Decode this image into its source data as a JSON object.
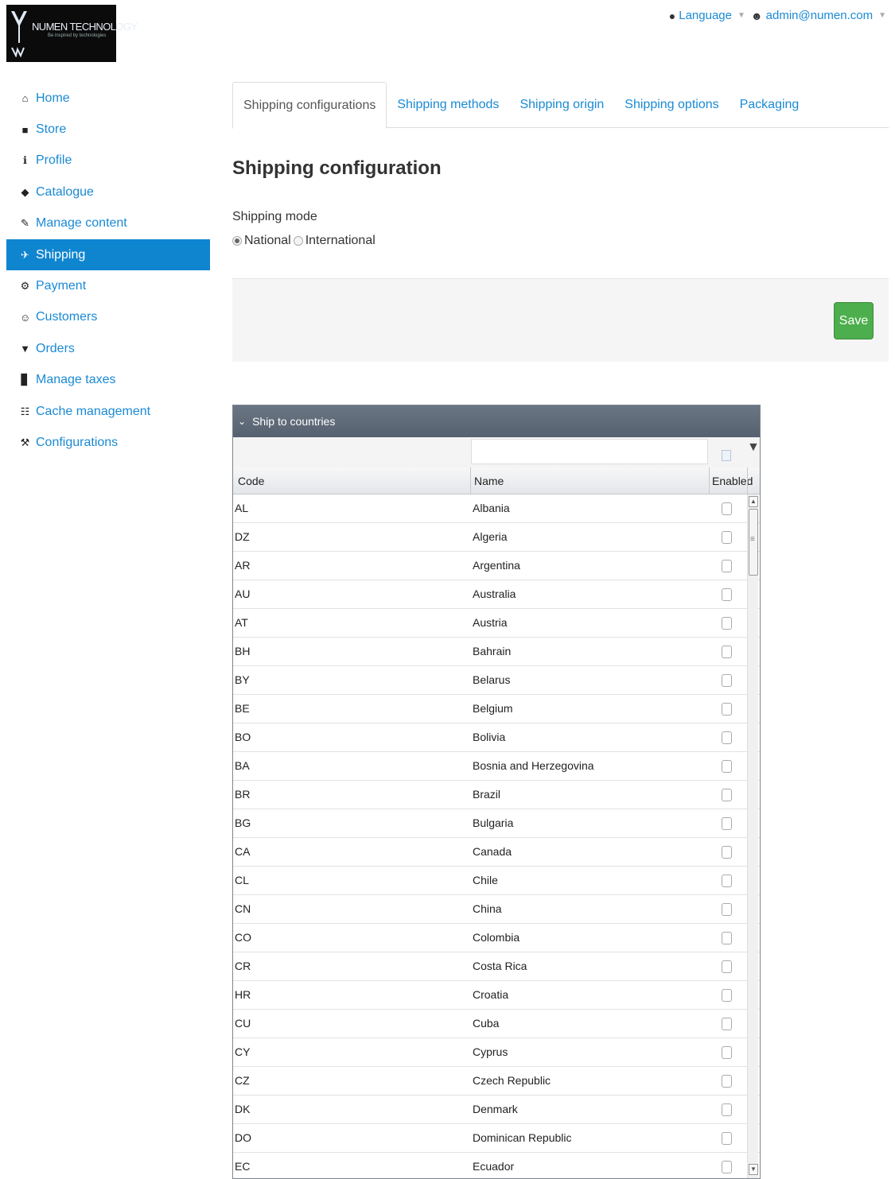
{
  "logo": {
    "text": "NUMEN TECHNOLOGY",
    "tagline": "Be inspired by technologies"
  },
  "topbar": {
    "language": "Language",
    "user": "admin@numen.com"
  },
  "sidebar": {
    "items": [
      {
        "label": "Home",
        "icon": "home-icon",
        "glyph": "⌂"
      },
      {
        "label": "Store",
        "icon": "file-icon",
        "glyph": "■"
      },
      {
        "label": "Profile",
        "icon": "info-icon",
        "glyph": "ℹ"
      },
      {
        "label": "Catalogue",
        "icon": "tag-icon",
        "glyph": "◆"
      },
      {
        "label": "Manage content",
        "icon": "pencil-icon",
        "glyph": "✎"
      },
      {
        "label": "Shipping",
        "icon": "plane-icon",
        "glyph": "✈",
        "active": true
      },
      {
        "label": "Payment",
        "icon": "cog-icon",
        "glyph": "⚙"
      },
      {
        "label": "Customers",
        "icon": "user-icon",
        "glyph": "☺"
      },
      {
        "label": "Orders",
        "icon": "cart-icon",
        "glyph": "▼"
      },
      {
        "label": "Manage taxes",
        "icon": "book-icon",
        "glyph": "▊"
      },
      {
        "label": "Cache management",
        "icon": "grid-icon",
        "glyph": "☷"
      },
      {
        "label": "Configurations",
        "icon": "wrench-icon",
        "glyph": "⚒"
      }
    ]
  },
  "tabs": [
    {
      "label": "Shipping configurations",
      "active": true
    },
    {
      "label": "Shipping methods"
    },
    {
      "label": "Shipping origin"
    },
    {
      "label": "Shipping options"
    },
    {
      "label": "Packaging"
    }
  ],
  "main": {
    "title": "Shipping configuration",
    "shipping_mode_label": "Shipping mode",
    "mode_options": [
      "National",
      "International"
    ],
    "selected_mode": "National",
    "save_label": "Save"
  },
  "grid": {
    "title": "Ship to countries",
    "columns": {
      "code": "Code",
      "name": "Name",
      "enabled": "Enabled"
    },
    "rows": [
      {
        "code": "AL",
        "name": "Albania"
      },
      {
        "code": "DZ",
        "name": "Algeria"
      },
      {
        "code": "AR",
        "name": "Argentina"
      },
      {
        "code": "AU",
        "name": "Australia"
      },
      {
        "code": "AT",
        "name": "Austria"
      },
      {
        "code": "BH",
        "name": "Bahrain"
      },
      {
        "code": "BY",
        "name": "Belarus"
      },
      {
        "code": "BE",
        "name": "Belgium"
      },
      {
        "code": "BO",
        "name": "Bolivia"
      },
      {
        "code": "BA",
        "name": "Bosnia and Herzegovina"
      },
      {
        "code": "BR",
        "name": "Brazil"
      },
      {
        "code": "BG",
        "name": "Bulgaria"
      },
      {
        "code": "CA",
        "name": "Canada"
      },
      {
        "code": "CL",
        "name": "Chile"
      },
      {
        "code": "CN",
        "name": "China"
      },
      {
        "code": "CO",
        "name": "Colombia"
      },
      {
        "code": "CR",
        "name": "Costa Rica"
      },
      {
        "code": "HR",
        "name": "Croatia"
      },
      {
        "code": "CU",
        "name": "Cuba"
      },
      {
        "code": "CY",
        "name": "Cyprus"
      },
      {
        "code": "CZ",
        "name": "Czech Republic"
      },
      {
        "code": "DK",
        "name": "Denmark"
      },
      {
        "code": "DO",
        "name": "Dominican Republic"
      },
      {
        "code": "EC",
        "name": "Ecuador"
      }
    ]
  },
  "colors": {
    "link": "#1a8ad4",
    "active_bg": "#0f85d0",
    "save_bg": "#4cae4c",
    "grid_header": "#5f6a78"
  }
}
